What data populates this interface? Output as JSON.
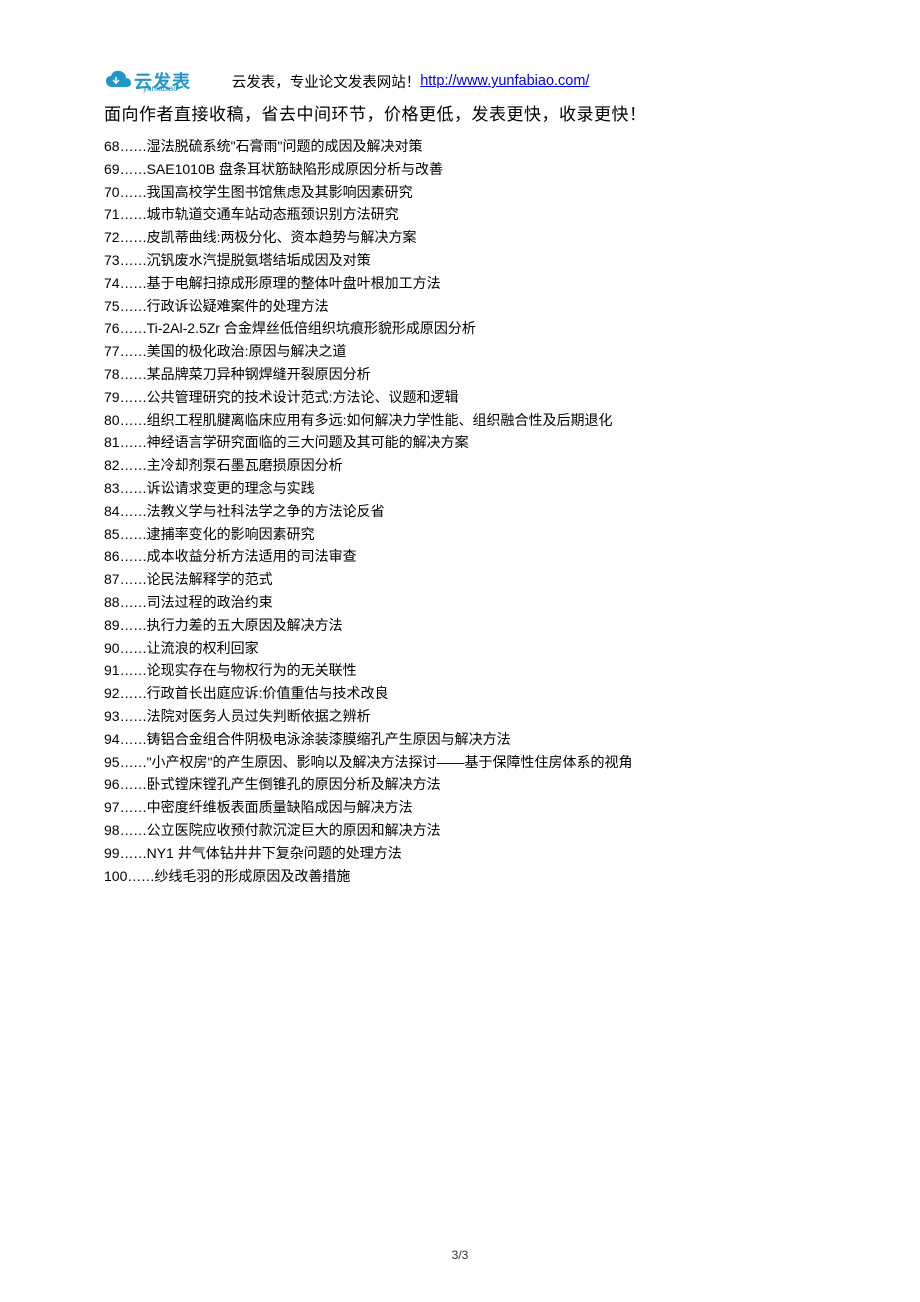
{
  "header": {
    "logo_text": "云发表",
    "logo_sub": "yunfabiao",
    "text_before_link": "云发表，专业论文发表网站！",
    "link_text": "http://www.yunfabiao.com/",
    "subheader": "面向作者直接收稿，省去中间环节，价格更低，发表更快，收录更快！"
  },
  "items": [
    {
      "num": "68",
      "title": "湿法脱硫系统\"石膏雨\"问题的成因及解决对策"
    },
    {
      "num": "69",
      "title": "SAE1010B 盘条耳状筋缺陷形成原因分析与改善"
    },
    {
      "num": "70",
      "title": "我国高校学生图书馆焦虑及其影响因素研究"
    },
    {
      "num": "71",
      "title": "城市轨道交通车站动态瓶颈识别方法研究"
    },
    {
      "num": "72",
      "title": "皮凯蒂曲线:两极分化、资本趋势与解决方案"
    },
    {
      "num": "73",
      "title": "沉钒废水汽提脱氨塔结垢成因及对策"
    },
    {
      "num": "74",
      "title": "基于电解扫掠成形原理的整体叶盘叶根加工方法"
    },
    {
      "num": "75",
      "title": "行政诉讼疑难案件的处理方法"
    },
    {
      "num": "76",
      "title": "Ti-2Al-2.5Zr 合金焊丝低倍组织坑痕形貌形成原因分析"
    },
    {
      "num": "77",
      "title": "美国的极化政治:原因与解决之道"
    },
    {
      "num": "78",
      "title": "某品牌菜刀异种钢焊缝开裂原因分析"
    },
    {
      "num": "79",
      "title": "公共管理研究的技术设计范式:方法论、议题和逻辑"
    },
    {
      "num": "80",
      "title": "组织工程肌腱离临床应用有多远:如何解决力学性能、组织融合性及后期退化"
    },
    {
      "num": "81",
      "title": "神经语言学研究面临的三大问题及其可能的解决方案"
    },
    {
      "num": "82",
      "title": "主冷却剂泵石墨瓦磨损原因分析"
    },
    {
      "num": "83",
      "title": "诉讼请求变更的理念与实践"
    },
    {
      "num": "84",
      "title": "法教义学与社科法学之争的方法论反省"
    },
    {
      "num": "85",
      "title": "逮捕率变化的影响因素研究"
    },
    {
      "num": "86",
      "title": "成本收益分析方法适用的司法审查"
    },
    {
      "num": "87",
      "title": "论民法解释学的范式"
    },
    {
      "num": "88",
      "title": "司法过程的政治约束"
    },
    {
      "num": "89",
      "title": "执行力差的五大原因及解决方法"
    },
    {
      "num": "90",
      "title": "让流浪的权利回家"
    },
    {
      "num": "91",
      "title": "论现实存在与物权行为的无关联性"
    },
    {
      "num": "92",
      "title": "行政首长出庭应诉:价值重估与技术改良"
    },
    {
      "num": "93",
      "title": "法院对医务人员过失判断依据之辨析"
    },
    {
      "num": "94",
      "title": "铸铝合金组合件阴极电泳涂装漆膜缩孔产生原因与解决方法"
    },
    {
      "num": "95",
      "title": "\"小产权房\"的产生原因、影响以及解决方法探讨——基于保障性住房体系的视角"
    },
    {
      "num": "96",
      "title": "卧式镗床镗孔产生倒锥孔的原因分析及解决方法"
    },
    {
      "num": "97",
      "title": "中密度纤维板表面质量缺陷成因与解决方法"
    },
    {
      "num": "98",
      "title": "公立医院应收预付款沉淀巨大的原因和解决方法"
    },
    {
      "num": "99",
      "title": "NY1 井气体钻井井下复杂问题的处理方法"
    },
    {
      "num": "100",
      "title": "纱线毛羽的形成原因及改善措施"
    }
  ],
  "dots": "……",
  "page_number": "3/3"
}
